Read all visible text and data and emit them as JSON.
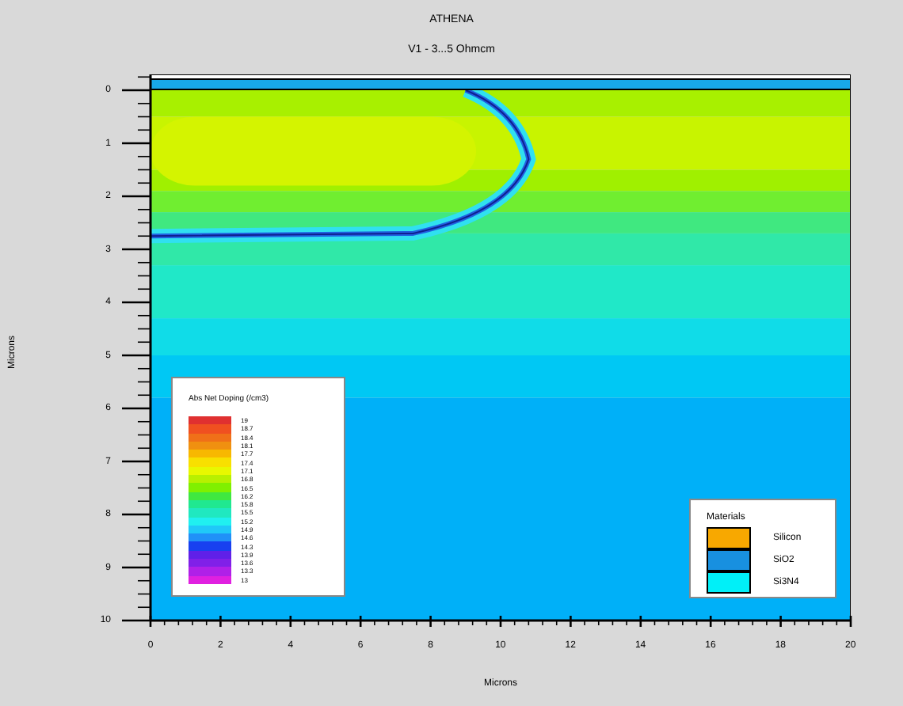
{
  "title": "ATHENA",
  "subtitle": "V1 - 3...5 Ohmcm",
  "y_axis": {
    "label": "Microns",
    "ticks": [
      "0",
      "1",
      "2",
      "3",
      "4",
      "5",
      "6",
      "7",
      "8",
      "9",
      "10"
    ]
  },
  "x_axis": {
    "label": "Microns",
    "ticks": [
      "0",
      "2",
      "4",
      "6",
      "8",
      "10",
      "12",
      "14",
      "16",
      "18",
      "20"
    ]
  },
  "doping_legend": {
    "title": "Abs Net Doping (/cm3)",
    "entries": [
      {
        "label": "19",
        "color": "#e03030"
      },
      {
        "label": "18.7",
        "color": "#f05020"
      },
      {
        "label": "18.4",
        "color": "#f07018"
      },
      {
        "label": "18.1",
        "color": "#f09010"
      },
      {
        "label": "17.7",
        "color": "#f8b800"
      },
      {
        "label": "17.4",
        "color": "#f8e000"
      },
      {
        "label": "17.1",
        "color": "#e8f800"
      },
      {
        "label": "16.8",
        "color": "#b8f000"
      },
      {
        "label": "16.5",
        "color": "#80f000"
      },
      {
        "label": "16.2",
        "color": "#40e840"
      },
      {
        "label": "15.8",
        "color": "#20e890"
      },
      {
        "label": "15.5",
        "color": "#20e8c0"
      },
      {
        "label": "15.2",
        "color": "#20f0f0"
      },
      {
        "label": "14.9",
        "color": "#20c8f8"
      },
      {
        "label": "14.6",
        "color": "#2090f8"
      },
      {
        "label": "14.3",
        "color": "#1840f0"
      },
      {
        "label": "13.9",
        "color": "#6020e8"
      },
      {
        "label": "13.6",
        "color": "#8020e8"
      },
      {
        "label": "13.3",
        "color": "#b020e8"
      },
      {
        "label": "13",
        "color": "#e020e0"
      }
    ]
  },
  "materials_legend": {
    "title": "Materials",
    "entries": [
      {
        "label": "Silicon",
        "color": "#f8a800"
      },
      {
        "label": "SiO2",
        "color": "#1890e0"
      },
      {
        "label": "Si3N4",
        "color": "#00f0f8"
      }
    ]
  }
}
